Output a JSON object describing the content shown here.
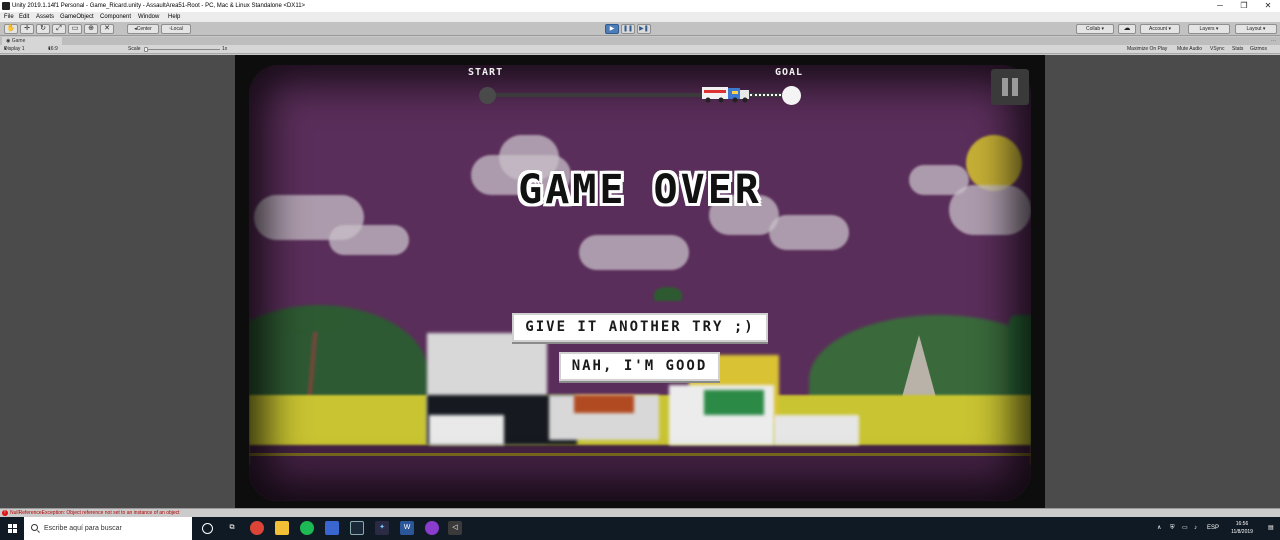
{
  "window": {
    "title": "Unity 2019.1.14f1 Personal - Game_Ricard.unity - AssaultArea51-Root - PC, Mac & Linux Standalone <DX11>",
    "minimize": "─",
    "maximize": "❐",
    "close": "✕"
  },
  "menubar": [
    "File",
    "Edit",
    "Assets",
    "GameObject",
    "Component",
    "Window",
    "Help"
  ],
  "toolbar": {
    "pivot": "Center",
    "space": "Local",
    "play": "▶",
    "pause": "❚❚",
    "step": "▶❚",
    "collab": "Collab",
    "account": "Account",
    "layers": "Layers",
    "layout": "Layout"
  },
  "game_tab": {
    "label": "Game",
    "display": "Display 1",
    "aspect": "16:9",
    "scale_label": "Scale",
    "scale_value": "1x",
    "maximize_on_play": "Maximize On Play",
    "mute_audio": "Mute Audio",
    "vsync": "VSync",
    "stats": "Stats",
    "gizmos": "Gizmos"
  },
  "game": {
    "progress_start": "START",
    "progress_goal": "GOAL",
    "progress_fraction": 0.77,
    "title": "GAME OVER",
    "retry_button": "GIVE IT ANOTHER TRY ;)",
    "quit_button": "NAH, I'M GOOD"
  },
  "console": {
    "error": "NullReferenceException: Object reference not set to an instance of an object"
  },
  "taskbar": {
    "search_placeholder": "Escribe aquí para buscar",
    "language": "ESP",
    "time": "16:56",
    "date": "11/8/2019"
  },
  "colors": {
    "sky": "#5a2e5a",
    "ground": "#c9c432",
    "play_accent": "#4c7db8",
    "error": "#b00000"
  }
}
